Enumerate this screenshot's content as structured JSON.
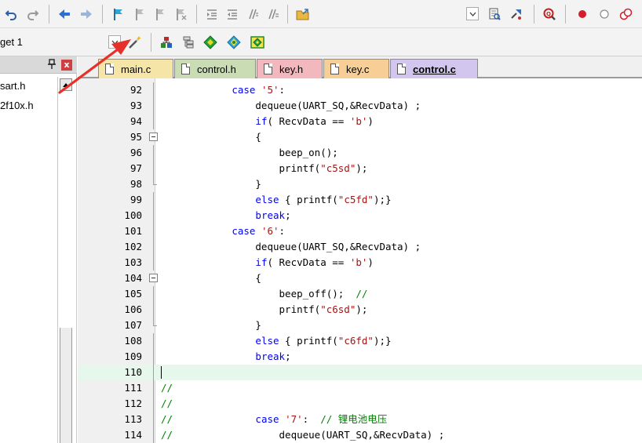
{
  "toolbar2": {
    "target_label": "get 1"
  },
  "left_panel": {
    "files": [
      "sart.h",
      "2f10x.h"
    ],
    "close_glyph": "x"
  },
  "tabs": [
    {
      "label": "main.c",
      "color": "#f5e6a8",
      "active": false
    },
    {
      "label": "control.h",
      "color": "#c9dcb4",
      "active": false
    },
    {
      "label": "key.h",
      "color": "#f2b8bd",
      "active": false
    },
    {
      "label": "key.c",
      "color": "#f7cf96",
      "active": false
    },
    {
      "label": "control.c",
      "color": "#d3c6ee",
      "active": true
    }
  ],
  "editor": {
    "current_line": "110",
    "lines": [
      {
        "n": "92",
        "fold": "line"
      },
      {
        "n": "93",
        "fold": "line"
      },
      {
        "n": "94",
        "fold": "line"
      },
      {
        "n": "95",
        "fold": "box"
      },
      {
        "n": "96",
        "fold": "line"
      },
      {
        "n": "97",
        "fold": "line"
      },
      {
        "n": "98",
        "fold": "end"
      },
      {
        "n": "99",
        "fold": "line"
      },
      {
        "n": "100",
        "fold": "line"
      },
      {
        "n": "101",
        "fold": "line"
      },
      {
        "n": "102",
        "fold": "line"
      },
      {
        "n": "103",
        "fold": "line"
      },
      {
        "n": "104",
        "fold": "box"
      },
      {
        "n": "105",
        "fold": "line"
      },
      {
        "n": "106",
        "fold": "line"
      },
      {
        "n": "107",
        "fold": "end"
      },
      {
        "n": "108",
        "fold": "line"
      },
      {
        "n": "109",
        "fold": "line"
      },
      {
        "n": "110",
        "fold": "line"
      },
      {
        "n": "111",
        "fold": "line"
      },
      {
        "n": "112",
        "fold": "line"
      },
      {
        "n": "113",
        "fold": "line"
      },
      {
        "n": "114",
        "fold": "line"
      }
    ],
    "code": [
      [
        {
          "t": "            "
        },
        {
          "t": "case",
          "c": "kw"
        },
        {
          "t": " "
        },
        {
          "t": "'5'",
          "c": "str"
        },
        {
          "t": ":"
        }
      ],
      [
        {
          "t": "                dequeue(UART_SQ,&RecvData) ;"
        }
      ],
      [
        {
          "t": "                "
        },
        {
          "t": "if",
          "c": "kw"
        },
        {
          "t": "( RecvData == "
        },
        {
          "t": "'b'",
          "c": "str"
        },
        {
          "t": ")"
        }
      ],
      [
        {
          "t": "                {"
        }
      ],
      [
        {
          "t": "                    beep_on();"
        }
      ],
      [
        {
          "t": "                    printf("
        },
        {
          "t": "\"c5sd\"",
          "c": "str"
        },
        {
          "t": ");"
        }
      ],
      [
        {
          "t": "                }"
        }
      ],
      [
        {
          "t": "                "
        },
        {
          "t": "else",
          "c": "kw"
        },
        {
          "t": " { printf("
        },
        {
          "t": "\"c5fd\"",
          "c": "str"
        },
        {
          "t": ");}"
        }
      ],
      [
        {
          "t": "                "
        },
        {
          "t": "break",
          "c": "kw"
        },
        {
          "t": ";"
        }
      ],
      [
        {
          "t": "            "
        },
        {
          "t": "case",
          "c": "kw"
        },
        {
          "t": " "
        },
        {
          "t": "'6'",
          "c": "str"
        },
        {
          "t": ":"
        }
      ],
      [
        {
          "t": "                dequeue(UART_SQ,&RecvData) ;"
        }
      ],
      [
        {
          "t": "                "
        },
        {
          "t": "if",
          "c": "kw"
        },
        {
          "t": "( RecvData == "
        },
        {
          "t": "'b'",
          "c": "str"
        },
        {
          "t": ")"
        }
      ],
      [
        {
          "t": "                {"
        }
      ],
      [
        {
          "t": "                    beep_off();  "
        },
        {
          "t": "//",
          "c": "cmt"
        }
      ],
      [
        {
          "t": "                    printf("
        },
        {
          "t": "\"c6sd\"",
          "c": "str"
        },
        {
          "t": ");"
        }
      ],
      [
        {
          "t": "                }"
        }
      ],
      [
        {
          "t": "                "
        },
        {
          "t": "else",
          "c": "kw"
        },
        {
          "t": " { printf("
        },
        {
          "t": "\"c6fd\"",
          "c": "str"
        },
        {
          "t": ");}"
        }
      ],
      [
        {
          "t": "                "
        },
        {
          "t": "break",
          "c": "kw"
        },
        {
          "t": ";"
        }
      ],
      [],
      [
        {
          "t": "//",
          "c": "cmt"
        }
      ],
      [
        {
          "t": "//",
          "c": "cmt"
        }
      ],
      [
        {
          "t": "//",
          "c": "cmt"
        },
        {
          "t": "              "
        },
        {
          "t": "case",
          "c": "kw"
        },
        {
          "t": " "
        },
        {
          "t": "'7'",
          "c": "str"
        },
        {
          "t": ":  "
        },
        {
          "t": "// 锂电池电压",
          "c": "cmt"
        }
      ],
      [
        {
          "t": "//",
          "c": "cmt"
        },
        {
          "t": "                  dequeue(UART_SQ,&RecvData) ;"
        }
      ]
    ]
  },
  "colors": {
    "keyword": "#0000ff",
    "string": "#a31515",
    "comment": "#008000",
    "current_line_bg": "#e6f7ec",
    "arrow": "#e8302a"
  },
  "icons": {
    "toolbar1": [
      "undo-icon",
      "redo-icon",
      "nav-back-icon",
      "nav-forward-icon",
      "bookmark-set-icon",
      "bookmark-prev-icon",
      "bookmark-next-icon",
      "bookmark-clear-icon",
      "indent-icon",
      "unindent-icon",
      "comment-icon",
      "uncomment-icon",
      "open-file-icon",
      "dropdown-icon",
      "find-in-files-icon",
      "debug-session-icon",
      "zoom-icon",
      "breakpoint-icon",
      "breakpoint-disable-icon",
      "breakpoint-kill-icon"
    ],
    "toolbar2": [
      "wand-icon",
      "load-icon",
      "manage-project-icon",
      "green-diamond-icon",
      "component-icon",
      "pack-installer-icon"
    ]
  }
}
